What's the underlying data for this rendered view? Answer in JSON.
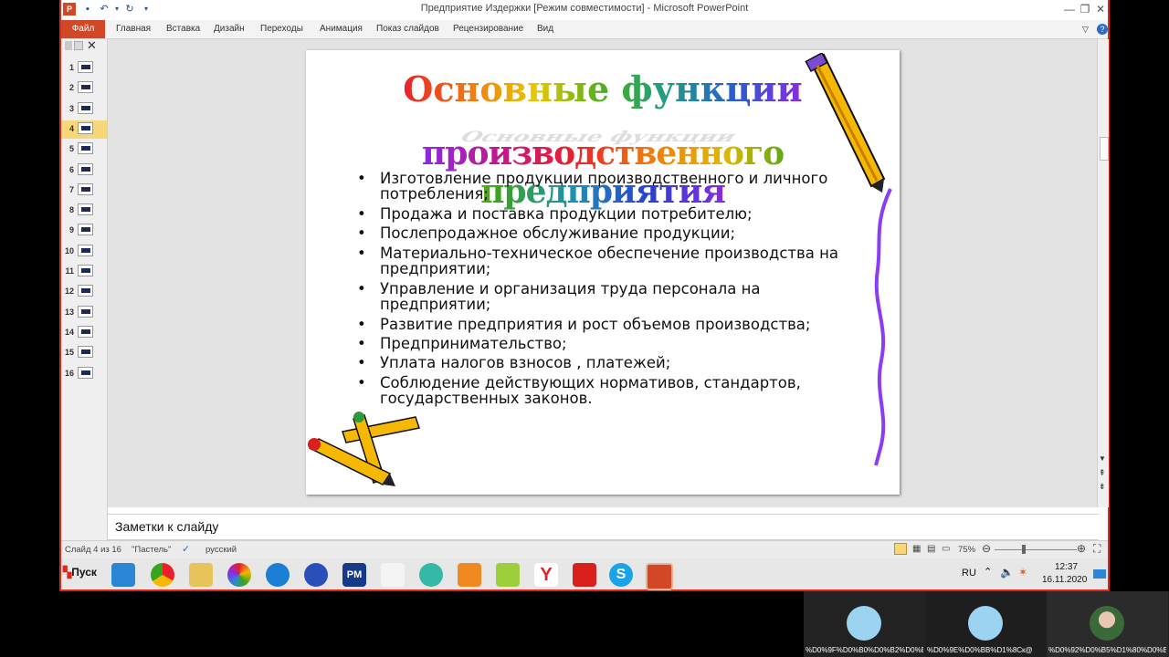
{
  "window": {
    "title": "Предприятие Издержки [Режим совместимости]  -  Microsoft PowerPoint",
    "controls": [
      "—",
      "❐",
      "✕"
    ]
  },
  "ribbon": {
    "file_tab": "Файл",
    "tabs": [
      "Главная",
      "Вставка",
      "Дизайн",
      "Переходы",
      "Анимация",
      "Показ слайдов",
      "Рецензирование",
      "Вид"
    ]
  },
  "slide_pane": {
    "numbers": [
      "1",
      "2",
      "3",
      "4",
      "5",
      "6",
      "7",
      "8",
      "9",
      "10",
      "11",
      "12",
      "13",
      "14",
      "15",
      "16"
    ],
    "selected": 4
  },
  "slide": {
    "title_line1": "Основные функции",
    "title_line2": "производственного предприятия",
    "bullets": [
      "Изготовление продукции производственного и личного потребления;",
      "Продажа и поставка продукции  потребителю;",
      "Послепродажное обслуживание продукции;",
      "Материально-техническое обеспечение производства на предприятии;",
      "Управление и организация труда персонала на предприятии;",
      "Развитие предприятия и рост объемов производства;",
      "Предпринимательство;",
      "Уплата налогов взносов , платежей;",
      "Соблюдение действующих нормативов, стандартов, государственных законов."
    ]
  },
  "notes": {
    "placeholder": "Заметки к слайду"
  },
  "status": {
    "slide_info": "Слайд 4 из 16",
    "theme": "\"Пастель\"",
    "language": "русский",
    "zoom": "75%"
  },
  "taskbar": {
    "start": "Пуск",
    "lang": "RU",
    "time": "12:37",
    "date": "16.11.2020"
  },
  "video": {
    "names": [
      "%D0%9F%D0%B0%D0%B2%D0%B...",
      "%D0%9E%D0%BB%D1%8Cк@",
      "%D0%92%D0%B5%D1%80%D0%B0..."
    ]
  },
  "colors": {
    "accent": "#d24726",
    "frame": "#e0261b",
    "selected_thumb": "#f6d77a"
  }
}
